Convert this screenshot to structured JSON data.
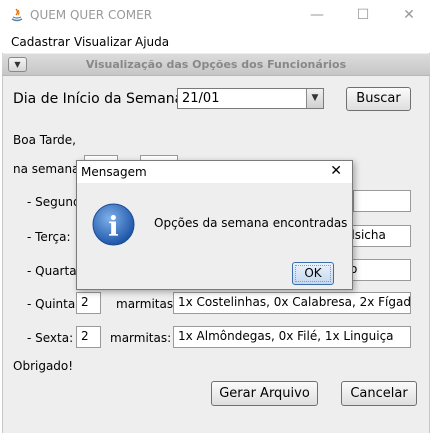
{
  "window": {
    "title": "QUEM QUER COMER",
    "minimize": "—",
    "maximize": "☐",
    "close": "✕"
  },
  "menu": [
    "Cadastrar",
    "Visualizar",
    "Ajuda"
  ],
  "internal_frame": {
    "title": "Visualização das Opções dos Funcionários",
    "menu_glyph": "▼"
  },
  "week_start": {
    "label": "Dia de Início da Semana:",
    "selected": "21/01",
    "arrow": "▼"
  },
  "search_button": "Buscar",
  "greeting": "Boa Tarde,",
  "week_line": "na semana",
  "days": [
    {
      "label": "- Segund",
      "qty": "",
      "desc": ""
    },
    {
      "label": "- Terça:",
      "qty": "",
      "desc": "alsicha"
    },
    {
      "label": "- Quarta:",
      "qty": "",
      "desc": "o"
    },
    {
      "label": "- Quinta:",
      "qty": "2",
      "desc": "1x Costelinhas, 0x Calabresa, 2x Fígado",
      "units_label": "marmitas:"
    },
    {
      "label": "- Sexta:",
      "qty": "2",
      "desc": "1x Almôndegas, 0x Filé, 1x Linguiça",
      "units_label": "marmitas:"
    }
  ],
  "thanks": "Obrigado!",
  "generate_button": "Gerar Arquivo",
  "cancel_button": "Cancelar",
  "dialog": {
    "title": "Mensagem",
    "close": "✕",
    "message": "Opções da semana encontradas",
    "ok": "OK",
    "icon_glyph": "i"
  }
}
